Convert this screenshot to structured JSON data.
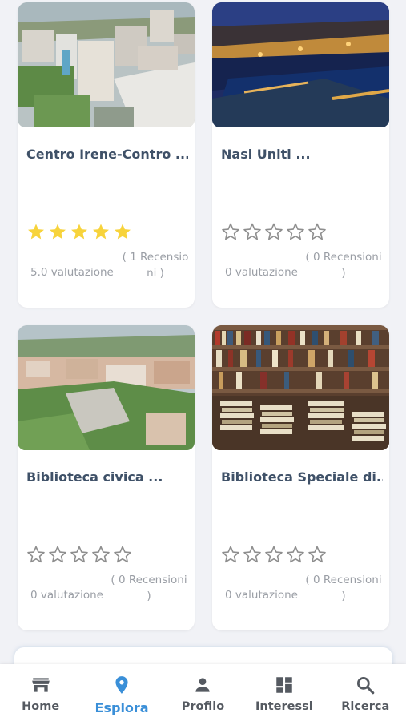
{
  "places": [
    {
      "title": "Centro Irene-Contro ...",
      "rating": 5.0,
      "score_label": "5.0 valutazione",
      "reviews_label": "( 1 Recensioni )",
      "image": "city-aerial-la-spezia"
    },
    {
      "title": "Nasi Uniti ...",
      "rating": 0,
      "score_label": "0 valutazione",
      "reviews_label": "( 0 Recensioni )",
      "image": "harbor-night"
    },
    {
      "title": "Biblioteca civica ...",
      "rating": 0,
      "score_label": "0 valutazione",
      "reviews_label": "( 0 Recensioni )",
      "image": "city-hill-aerial"
    },
    {
      "title": "Biblioteca Speciale di...",
      "rating": 0,
      "score_label": "0 valutazione",
      "reviews_label": "( 0 Recensioni )",
      "image": "book-stacks"
    }
  ],
  "nav": {
    "items": [
      {
        "label": "Home",
        "icon": "store-icon"
      },
      {
        "label": "Esplora",
        "icon": "location-pin-icon"
      },
      {
        "label": "Profilo",
        "icon": "person-icon"
      },
      {
        "label": "Interessi",
        "icon": "dashboard-icon"
      },
      {
        "label": "Ricerca",
        "icon": "search-icon"
      }
    ],
    "active": "Esplora"
  },
  "colors": {
    "accent": "#3a8fd8",
    "star_filled": "#f7d33b",
    "star_empty": "#8e8e8e",
    "title": "#3f5168"
  }
}
